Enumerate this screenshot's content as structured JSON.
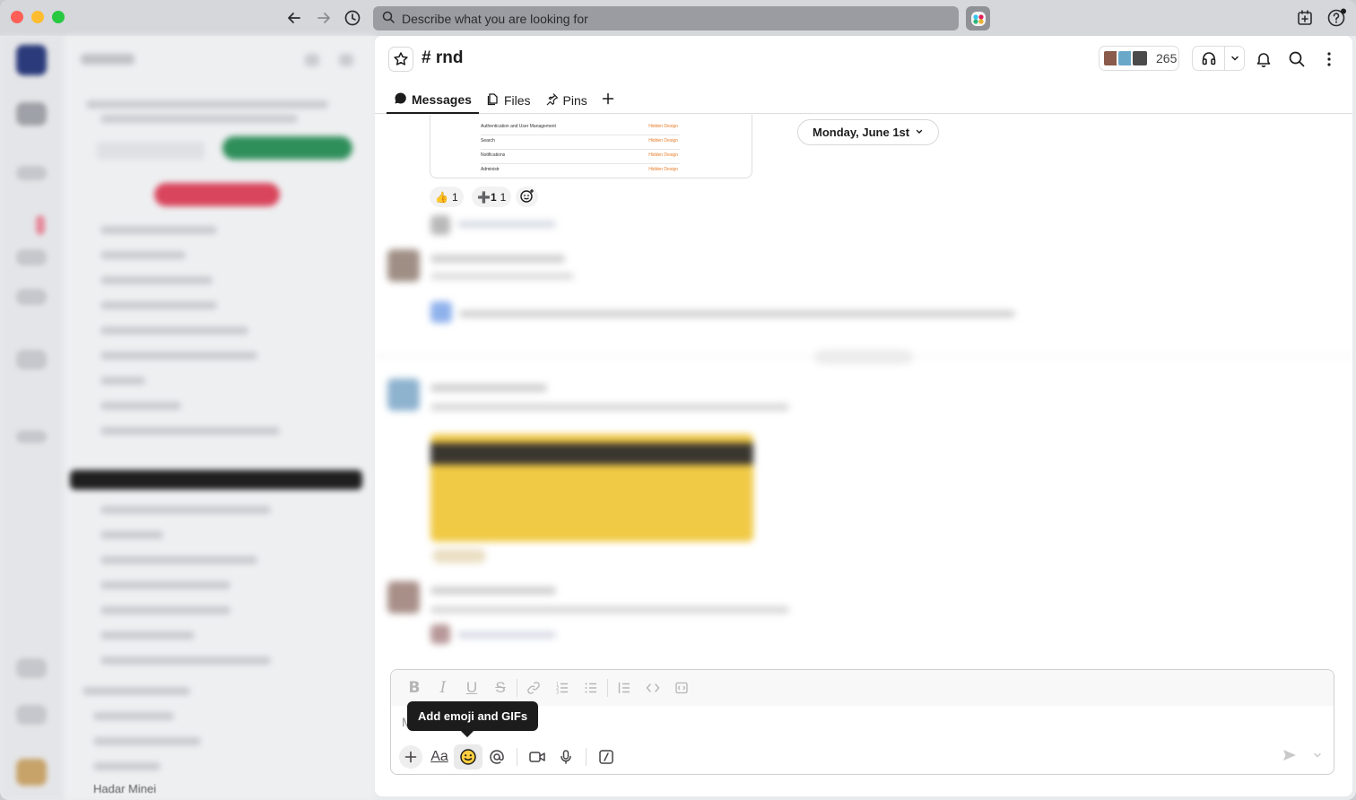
{
  "search": {
    "placeholder": "Describe what you are looking for"
  },
  "channel": {
    "name": "# rnd",
    "member_count": "265",
    "tabs": [
      {
        "label": "Messages",
        "icon": "message-bubble-icon",
        "active": true
      },
      {
        "label": "Files",
        "icon": "files-icon",
        "active": false
      },
      {
        "label": "Pins",
        "icon": "pin-icon",
        "active": false
      }
    ]
  },
  "messages": {
    "date_divider": "Monday, June 1st",
    "attachment_rows": [
      {
        "label": "Authentication and User Management",
        "status": "Hidden Design"
      },
      {
        "label": "Search",
        "status": "Hidden Design"
      },
      {
        "label": "Notifications",
        "status": "Hidden Design"
      },
      {
        "label": "Administr",
        "status": "Hidden Design"
      }
    ],
    "reactions": [
      {
        "emoji": "👍",
        "count": "1"
      },
      {
        "emoji": "➕1",
        "count": "1"
      }
    ]
  },
  "composer": {
    "placeholder": "M",
    "tooltip": "Add emoji and GIFs",
    "format_tools": [
      "bold",
      "italic",
      "underline",
      "strikethrough",
      "link",
      "ordered-list",
      "bulleted-list",
      "blockquote",
      "code",
      "code-block"
    ],
    "actions": [
      "plus",
      "formatting",
      "emoji",
      "mention",
      "video",
      "audio",
      "slash-command"
    ]
  },
  "sidebar": {
    "footer_user": "Hadar Minei"
  },
  "colors": {
    "accent": "#1d1c1d",
    "reaction_bg": "#f2f2f2",
    "sidebar_highlight": "#1f1f1f",
    "cta_green": "#2f8f5b",
    "cta_red": "#d9455c"
  }
}
